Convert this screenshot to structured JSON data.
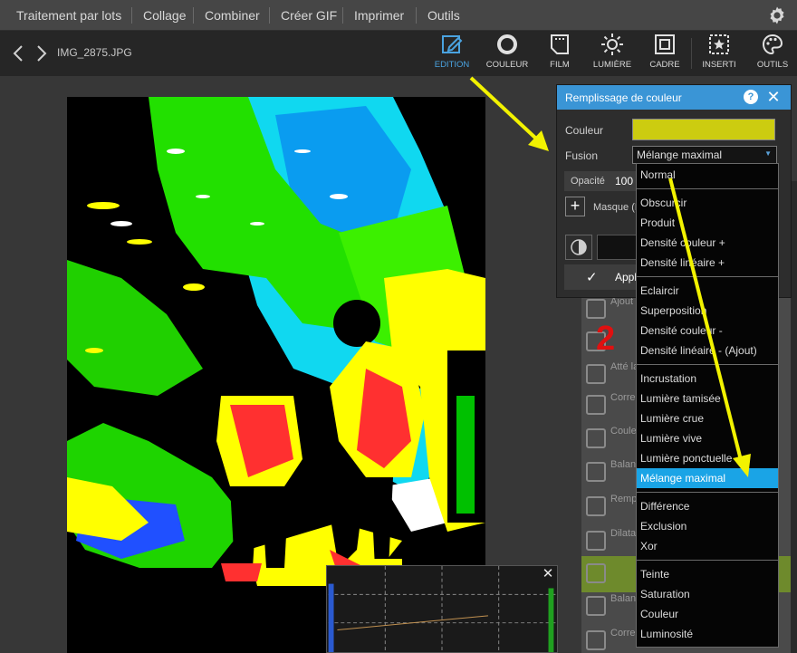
{
  "menu": {
    "items": [
      "Traitement par lots",
      "Collage",
      "Combiner",
      "Créer GIF",
      "Imprimer",
      "Outils"
    ],
    "settings_icon": "gear-icon"
  },
  "toolbar": {
    "filename": "IMG_2875.JPG",
    "tools": [
      {
        "label": "EDITION",
        "icon": "edit-pencil-icon",
        "active": true
      },
      {
        "label": "COULEUR",
        "icon": "color-ring-icon",
        "active": false
      },
      {
        "label": "FILM",
        "icon": "film-icon",
        "active": false
      },
      {
        "label": "LUMIÈRE",
        "icon": "sun-icon",
        "active": false
      },
      {
        "label": "CADRE",
        "icon": "frame-icon",
        "active": false
      },
      {
        "label": "INSERTI",
        "icon": "insert-star-icon",
        "active": false
      },
      {
        "label": "OUTILS",
        "icon": "palette-icon",
        "active": false
      }
    ]
  },
  "dialog": {
    "title": "Remplissage de couleur",
    "color_label": "Couleur",
    "color_value": "#cccc10",
    "fusion_label": "Fusion",
    "fusion_value": "Mélange maximal",
    "opacity_label": "Opacité",
    "opacity_value": "100",
    "mask_label": "Masque (M",
    "apply_label": "Applic"
  },
  "blend_modes": {
    "groups": [
      [
        "Normal"
      ],
      [
        "Obscurcir",
        "Produit",
        "Densité couleur +",
        "Densité linéaire +"
      ],
      [
        "Eclaircir",
        "Superposition",
        "Densité couleur -",
        "Densité linéaire - (Ajout)"
      ],
      [
        "Incrustation",
        "Lumière tamisée",
        "Lumière crue",
        "Lumière vive",
        "Lumière ponctuelle",
        "Mélange maximal"
      ],
      [
        "Différence",
        "Exclusion",
        "Xor"
      ],
      [
        "Teinte",
        "Saturation",
        "Couleur",
        "Luminosité"
      ]
    ],
    "selected": "Mélange maximal"
  },
  "side_panel": {
    "items": [
      "Ajout",
      "",
      "Atté la pe",
      "Corre voile",
      "Coule point",
      "Balan blanc",
      "Remp coule",
      "Dilata",
      "",
      "Balan coule",
      "Corre sélect"
    ]
  },
  "annotation": {
    "step_number": "2",
    "arrow_color": "#f2f200"
  },
  "colors": {
    "accent": "#3a95d6",
    "selected_item": "#1aa4e6",
    "menubar": "#464646",
    "toolbar": "#262626"
  }
}
